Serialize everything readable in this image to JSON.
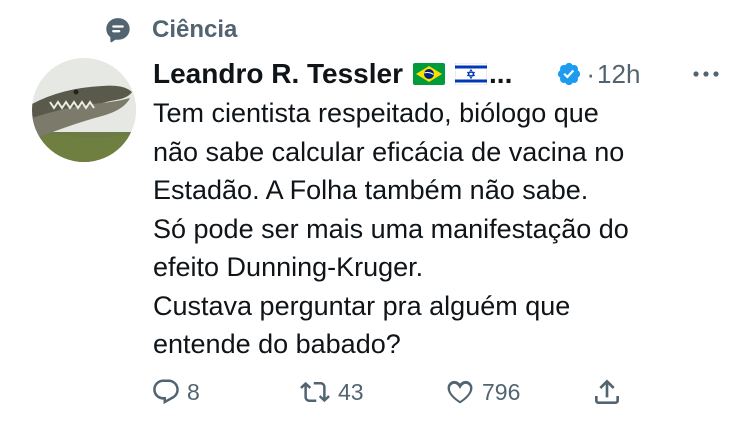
{
  "context": {
    "label": "Ciência",
    "icon": "topic-icon"
  },
  "tweet": {
    "author_name": "Leandro R. Tessler",
    "author_flags": [
      "brazil-flag",
      "israel-flag"
    ],
    "name_overflow": "...",
    "verified": true,
    "separator": "·",
    "timestamp": "12h",
    "text_lines": [
      "Tem cientista respeitado, biólogo que",
      "não sabe calcular eficácia de vacina no",
      "Estadão. A Folha também não sabe.",
      "Só pode ser mais uma manifestação do",
      "efeito Dunning-Kruger.",
      "Custava perguntar pra alguém que",
      "entende do babado?"
    ]
  },
  "actions": {
    "replies": "8",
    "retweets": "43",
    "likes": "796"
  },
  "colors": {
    "text": "#0f1419",
    "secondary": "#536471",
    "verified": "#1d9bf0"
  }
}
